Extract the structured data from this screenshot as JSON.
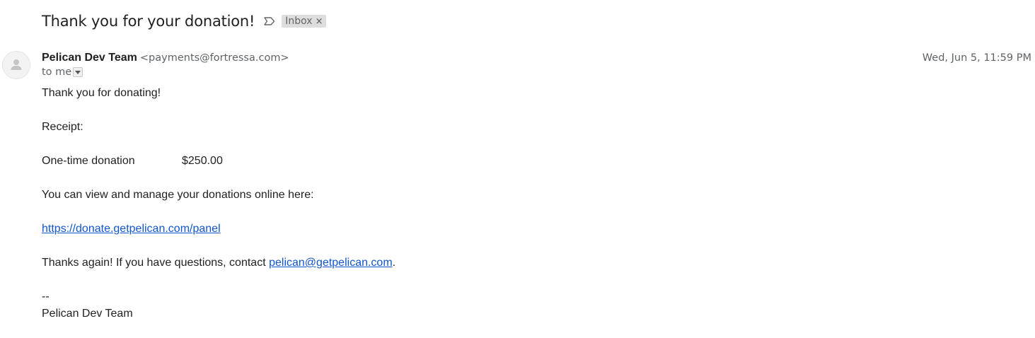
{
  "message": {
    "subject": "Thank you for your donation!",
    "label": "Inbox",
    "label_remove": "×",
    "sender": {
      "name": "Pelican Dev Team",
      "email": "<payments@fortressa.com>"
    },
    "recipient": "to me",
    "date": "Wed, Jun 5, 11:59 PM"
  },
  "body": {
    "greeting": "Thank you for donating!",
    "receipt_heading": "Receipt:",
    "receipt": {
      "item": "One-time donation",
      "amount": "$250.00"
    },
    "manage_text": "You can view and manage your donations online here:",
    "panel_link": "https://donate.getpelican.com/panel",
    "thanks_prefix": "Thanks again! If you have questions, contact ",
    "contact_email": "pelican@getpelican.com",
    "thanks_suffix": ".",
    "signature_separator": "--",
    "signature_name": "Pelican Dev Team"
  },
  "icons": {
    "importance": "label-importance-icon",
    "avatar": "default-avatar-icon",
    "details": "dropdown-arrow-icon"
  },
  "colors": {
    "link": "#1155cc",
    "chip_background": "#dddddd",
    "muted_text": "#5f6368"
  }
}
